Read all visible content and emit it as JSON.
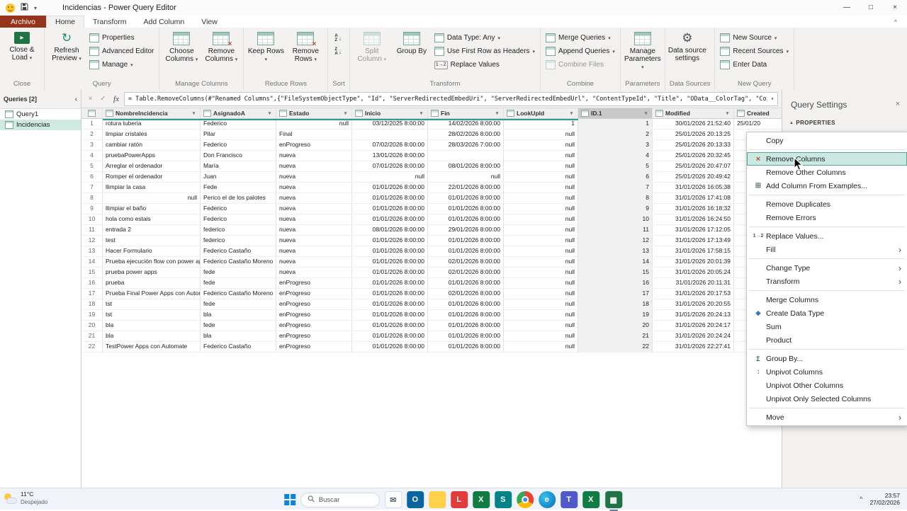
{
  "colors": {
    "accent_teal": "#2f9e8f",
    "file_tab_red": "#96331c",
    "excel_green": "#217346",
    "selection_green": "#cfe9e3"
  },
  "icons": {
    "dropdown": "▾",
    "ribbon_collapse": "^",
    "pane_collapse": "‹",
    "cancel": "×",
    "check": "✓",
    "fx": "fx",
    "formula_dropdown": "▾",
    "properties_arrow": "▲",
    "tray_chevron": "^",
    "window_minimize": "—",
    "window_maximize": "□",
    "window_close": "×",
    "panel_close": "×",
    "filter": "▾"
  },
  "title_bar": {
    "title": "Incidencias - Power Query Editor"
  },
  "tabs": {
    "file": "Archivo",
    "items": [
      "Home",
      "Transform",
      "Add Column",
      "View"
    ],
    "active": "Home"
  },
  "ribbon": {
    "groups": [
      {
        "id": "close",
        "label": "Close",
        "items": [
          {
            "kind": "large",
            "name": "close-and-load",
            "label": "Close & Load",
            "icon": "close-load",
            "dropdown": true
          }
        ]
      },
      {
        "id": "query",
        "label": "Query",
        "items": [
          {
            "kind": "large",
            "name": "refresh-preview",
            "label": "Refresh Preview",
            "icon": "refresh",
            "dropdown": true
          },
          {
            "kind": "stack",
            "items": [
              {
                "name": "properties",
                "label": "Properties",
                "icon": "mini"
              },
              {
                "name": "advanced-editor",
                "label": "Advanced Editor",
                "icon": "mini"
              },
              {
                "name": "manage",
                "label": "Manage",
                "icon": "mini",
                "dropdown": true
              }
            ]
          }
        ]
      },
      {
        "id": "manage-columns",
        "label": "Manage Columns",
        "items": [
          {
            "kind": "large",
            "name": "choose-columns",
            "label": "Choose Columns",
            "icon": "table",
            "dropdown": true
          },
          {
            "kind": "large",
            "name": "remove-columns",
            "label": "Remove Columns",
            "icon": "table-remove",
            "dropdown": true
          }
        ]
      },
      {
        "id": "reduce-rows",
        "label": "Reduce Rows",
        "items": [
          {
            "kind": "large",
            "name": "keep-rows",
            "label": "Keep Rows",
            "icon": "table",
            "dropdown": true
          },
          {
            "kind": "large",
            "name": "remove-rows",
            "label": "Remove Rows",
            "icon": "table-remove",
            "dropdown": true
          }
        ]
      },
      {
        "id": "sort",
        "label": "Sort",
        "items": [
          {
            "kind": "stack",
            "items": [
              {
                "name": "sort-ascending",
                "label": "",
                "icon": "sort-az"
              },
              {
                "name": "sort-descending",
                "label": "",
                "icon": "sort-za"
              }
            ]
          }
        ]
      },
      {
        "id": "transform",
        "label": "Transform",
        "items": [
          {
            "kind": "large",
            "name": "split-column",
            "label": "Split Column",
            "icon": "table",
            "dropdown": true,
            "disabled": true
          },
          {
            "kind": "large",
            "name": "group-by",
            "label": "Group By",
            "icon": "table"
          },
          {
            "kind": "stack",
            "items": [
              {
                "name": "data-type",
                "label": "Data Type: Any",
                "icon": "mini",
                "dropdown": true
              },
              {
                "name": "use-first-row-as-headers",
                "label": "Use First Row as Headers",
                "icon": "mini",
                "dropdown": true
              },
              {
                "name": "replace-values",
                "label": "Replace Values",
                "icon": "replace"
              }
            ]
          }
        ]
      },
      {
        "id": "combine",
        "label": "Combine",
        "items": [
          {
            "kind": "stack",
            "items": [
              {
                "name": "merge-queries",
                "label": "Merge Queries",
                "icon": "mini",
                "dropdown": true
              },
              {
                "name": "append-queries",
                "label": "Append Queries",
                "icon": "mini",
                "dropdown": true
              },
              {
                "name": "combine-files",
                "label": "Combine Files",
                "icon": "mini",
                "disabled": true
              }
            ]
          }
        ]
      },
      {
        "id": "parameters",
        "label": "Parameters",
        "items": [
          {
            "kind": "large",
            "name": "manage-parameters",
            "label": "Manage Parameters",
            "icon": "table",
            "dropdown": true
          }
        ]
      },
      {
        "id": "data-sources",
        "label": "Data Sources",
        "items": [
          {
            "kind": "large",
            "name": "data-source-settings",
            "label": "Data source settings",
            "icon": "gear"
          }
        ]
      },
      {
        "id": "new-query",
        "label": "New Query",
        "items": [
          {
            "kind": "stack",
            "items": [
              {
                "name": "new-source",
                "label": "New Source",
                "icon": "mini",
                "dropdown": true
              },
              {
                "name": "recent-sources",
                "label": "Recent Sources",
                "icon": "mini",
                "dropdown": true
              },
              {
                "name": "enter-data",
                "label": "Enter Data",
                "icon": "mini"
              }
            ]
          }
        ]
      }
    ]
  },
  "formula_bar": {
    "formula": "= Table.RemoveColumns(#\"Renamed Columns\",{\"FileSystemObjectType\", \"Id\", \"ServerRedirectedEmbedUri\", \"ServerRedirectedEmbedUrl\", \"ContentTypeId\", \"Title\", \"OData__ColorTag\", \"ComplianceAssetId\"})"
  },
  "queries_pane": {
    "header": "Queries [2]",
    "items": [
      {
        "name": "Query1",
        "selected": false
      },
      {
        "name": "Incidencias",
        "selected": true
      }
    ]
  },
  "table": {
    "columns": [
      {
        "name": "NombreIncidencia",
        "width": 138,
        "align": "left"
      },
      {
        "name": "AsignadoA",
        "width": 107,
        "align": "left"
      },
      {
        "name": "Estado",
        "width": 107,
        "align": "left"
      },
      {
        "name": "Inicio",
        "width": 107,
        "align": "right"
      },
      {
        "name": "Fin",
        "width": 107,
        "align": "right"
      },
      {
        "name": "LookUpId",
        "width": 105,
        "align": "right"
      },
      {
        "name": "ID.1",
        "width": 105,
        "align": "right",
        "selected": true
      },
      {
        "name": "Modified",
        "width": 115,
        "align": "right"
      },
      {
        "name": "Created",
        "width": 110,
        "align": "left"
      }
    ],
    "rows": [
      [
        "rotura tuberia",
        "Federico",
        "null",
        "03/12/2025 8:00:00",
        "14/02/2026 8:00:00",
        "1",
        "1",
        "30/01/2026 21:52:40",
        "25/01/20"
      ],
      [
        "limpiar cristales",
        "Pilar",
        "Final",
        "",
        "28/02/2026 8:00:00",
        "null",
        "2",
        "25/01/2026 20:13:25",
        ""
      ],
      [
        "cambiar ratón",
        "Federico",
        "enProgreso",
        "07/02/2026 8:00:00",
        "28/03/2026 7:00:00",
        "null",
        "3",
        "25/01/2026 20:13:33",
        ""
      ],
      [
        "pruebaPowerApps",
        "Don Francisco",
        "nueva",
        "13/01/2026 8:00:00",
        "",
        "null",
        "4",
        "25/01/2026 20:32:45",
        ""
      ],
      [
        "Arreglar el ordenador",
        "María",
        "nueva",
        "07/01/2026 8:00:00",
        "08/01/2026 8:00:00",
        "null",
        "5",
        "25/01/2026 20:47:07",
        ""
      ],
      [
        "Romper el ordenador",
        "Juan",
        "nueva",
        "null",
        "null",
        "null",
        "6",
        "25/01/2026 20:49:42",
        ""
      ],
      [
        "llimpiar la casa",
        "Fede",
        "nueva",
        "01/01/2026 8:00:00",
        "22/01/2026 8:00:00",
        "null",
        "7",
        "31/01/2026 16:05:38",
        ""
      ],
      [
        "null",
        "Perico el de los palotes",
        "nueva",
        "01/01/2026 8:00:00",
        "01/01/2026 8:00:00",
        "null",
        "8",
        "31/01/2026 17:41:08",
        ""
      ],
      [
        "llimpiar el baño",
        "Federico",
        "nueva",
        "01/01/2026 8:00:00",
        "01/01/2026 8:00:00",
        "null",
        "9",
        "31/01/2026 16:18:32",
        ""
      ],
      [
        "hola como estais",
        "Federico",
        "nueva",
        "01/01/2026 8:00:00",
        "01/01/2026 8:00:00",
        "null",
        "10",
        "31/01/2026 16:24:50",
        ""
      ],
      [
        "entrada 2",
        "federico",
        "nueva",
        "08/01/2026 8:00:00",
        "29/01/2026 8:00:00",
        "null",
        "11",
        "31/01/2026 17:12:05",
        ""
      ],
      [
        "test",
        "federico",
        "nueva",
        "01/01/2026 8:00:00",
        "01/01/2026 8:00:00",
        "null",
        "12",
        "31/01/2026 17:13:49",
        ""
      ],
      [
        "Hacer Formulario",
        "Federico Castaño",
        "nueva",
        "01/01/2026 8:00:00",
        "01/01/2026 8:00:00",
        "null",
        "13",
        "31/01/2026 17:58:15",
        ""
      ],
      [
        "Prueba ejecución flow con power apps",
        "Federico Castaño Moreno",
        "nueva",
        "01/01/2026 8:00:00",
        "02/01/2026 8:00:00",
        "null",
        "14",
        "31/01/2026 20:01:39",
        ""
      ],
      [
        "prueba power apps",
        "fede",
        "nueva",
        "01/01/2026 8:00:00",
        "02/01/2026 8:00:00",
        "null",
        "15",
        "31/01/2026 20:05:24",
        ""
      ],
      [
        "prueba",
        "fede",
        "enProgreso",
        "01/01/2026 8:00:00",
        "01/01/2026 8:00:00",
        "null",
        "16",
        "31/01/2026 20:11:31",
        ""
      ],
      [
        "Prueba Final Power Apps con Automate",
        "Federico Castaño Moreno",
        "enProgreso",
        "01/01/2026 8:00:00",
        "02/01/2026 8:00:00",
        "null",
        "17",
        "31/01/2026 20:17:53",
        ""
      ],
      [
        "tst",
        "fede",
        "enProgreso",
        "01/01/2026 8:00:00",
        "01/01/2026 8:00:00",
        "null",
        "18",
        "31/01/2026 20:20:55",
        ""
      ],
      [
        "tst",
        "bla",
        "enProgreso",
        "01/01/2026 8:00:00",
        "01/01/2026 8:00:00",
        "null",
        "19",
        "31/01/2026 20:24:13",
        ""
      ],
      [
        "bla",
        "fede",
        "enProgreso",
        "01/01/2026 8:00:00",
        "01/01/2026 8:00:00",
        "null",
        "20",
        "31/01/2026 20:24:17",
        ""
      ],
      [
        "bla",
        "bla",
        "enProgreso",
        "01/01/2026 8:00:00",
        "01/01/2026 8:00:00",
        "null",
        "21",
        "31/01/2026 20:24:24",
        ""
      ],
      [
        "TestPower Apps con Automate",
        "Federico Castaño",
        "enProgreso",
        "01/01/2026 8:00:00",
        "01/01/2026 8:00:00",
        "null",
        "22",
        "31/01/2026 22:27:41",
        ""
      ]
    ]
  },
  "query_settings": {
    "title": "Query Settings",
    "section": "PROPERTIES"
  },
  "context_menu": {
    "items": [
      {
        "label": "Copy"
      },
      {
        "sep": true
      },
      {
        "label": "Remove Columns",
        "icon": "remove-columns-icon",
        "highlighted": true
      },
      {
        "label": "Remove Other Columns"
      },
      {
        "label": "Add Column From Examples...",
        "icon": "add-column-from-examples-icon"
      },
      {
        "sep": true
      },
      {
        "label": "Remove Duplicates"
      },
      {
        "label": "Remove Errors"
      },
      {
        "sep": true
      },
      {
        "label": "Replace Values...",
        "icon": "replace-values-icon"
      },
      {
        "label": "Fill",
        "submenu": true
      },
      {
        "sep": true
      },
      {
        "label": "Change Type",
        "submenu": true
      },
      {
        "label": "Transform",
        "submenu": true
      },
      {
        "sep": true
      },
      {
        "label": "Merge Columns"
      },
      {
        "label": "Create Data Type",
        "icon": "create-data-type-icon"
      },
      {
        "label": "Sum"
      },
      {
        "label": "Product"
      },
      {
        "sep": true
      },
      {
        "label": "Group By...",
        "icon": "group-by-icon"
      },
      {
        "label": "Unpivot Columns",
        "icon": "unpivot-columns-icon"
      },
      {
        "label": "Unpivot Other Columns"
      },
      {
        "label": "Unpivot Only Selected Columns"
      },
      {
        "sep": true
      },
      {
        "label": "Move",
        "submenu": true
      }
    ]
  },
  "taskbar": {
    "weather": {
      "temp": "11°C",
      "condition": "Despejado"
    },
    "search": "Buscar",
    "time": "23:57",
    "date": "27/02/2026",
    "app_icons": [
      {
        "name": "mail-app-icon",
        "bg": "#ffffff",
        "fg": "#5a6b7d",
        "glyph": "✉",
        "border": true
      },
      {
        "name": "outlook-icon",
        "bg": "#0a64a0",
        "glyph": "O"
      },
      {
        "name": "folder-icon",
        "bg": "#ffd04a",
        "fg": "#c99700",
        "glyph": ""
      },
      {
        "name": "l-app-icon",
        "bg": "#e23b3b",
        "glyph": "L"
      },
      {
        "name": "excel-icon",
        "bg": "#107c41",
        "glyph": "X"
      },
      {
        "name": "sharepoint-icon",
        "bg": "#038387",
        "glyph": "S"
      },
      {
        "name": "chrome-icon",
        "special": "chrome",
        "glyph": ""
      },
      {
        "name": "edge-icon",
        "special": "edge",
        "glyph": "e"
      },
      {
        "name": "teams-icon",
        "bg": "#5059c9",
        "glyph": "T"
      },
      {
        "name": "excel-2-icon",
        "bg": "#107c41",
        "glyph": "X"
      },
      {
        "name": "power-query-icon",
        "bg": "#217346",
        "glyph": "▦",
        "active": true
      }
    ]
  }
}
